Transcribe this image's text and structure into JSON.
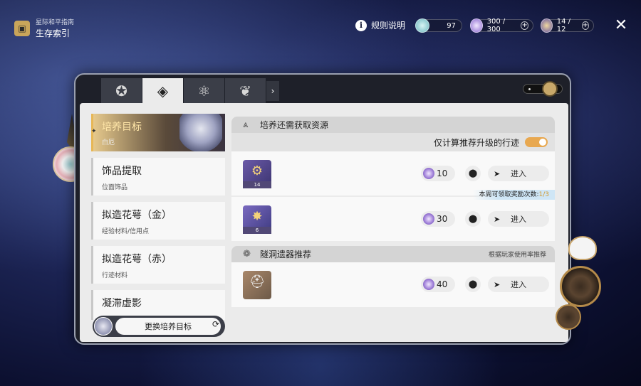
{
  "header": {
    "guide_small": "星际和平指南",
    "guide_big": "生存索引",
    "rules_label": "规则说明",
    "currency1_value": "97",
    "currency2_value": "300 / 300",
    "currency3_value": "14 / 12",
    "plus_symbol": "+",
    "close_symbol": "✕",
    "info_symbol": "i"
  },
  "tabs": [
    {
      "icon": "✪"
    },
    {
      "icon": "◈"
    },
    {
      "icon": "⚛"
    },
    {
      "icon": "❦"
    }
  ],
  "tab_more": "›",
  "sidebar": {
    "items": [
      {
        "title": "培养目标",
        "subtitle": "白厄"
      },
      {
        "title": "饰品提取",
        "subtitle": "位面饰品"
      },
      {
        "title": "拟造花萼（金）",
        "subtitle": "经验材料/信用点"
      },
      {
        "title": "拟造花萼（赤）",
        "subtitle": "行迹材料"
      },
      {
        "title": "凝滞虚影",
        "subtitle": ""
      }
    ],
    "switch_label": "更换培养目标",
    "refresh_symbol": "⟳",
    "pin_symbol": "✦"
  },
  "section1": {
    "title": "培养还需获取资源",
    "toggle_label": "仅计算推荐升级的行迹",
    "toggle_on": true,
    "rows": [
      {
        "count": "14",
        "cost": "10",
        "enter": "进入",
        "glyph": "⚙"
      },
      {
        "count": "6",
        "cost": "30",
        "enter": "进入",
        "glyph": "✸"
      }
    ],
    "weekly_prefix": "本周可领取奖励次数:",
    "weekly_value": "1/3"
  },
  "section2": {
    "title": "隧洞遗器推荐",
    "right_note": "根据玩家使用率推荐",
    "rows": [
      {
        "cost": "40",
        "enter": "进入",
        "glyph": "⛑"
      }
    ]
  },
  "icons": {
    "pin": "⬤",
    "arrow": "➤",
    "section1_icon": "⩓",
    "section2_icon": "❁"
  },
  "colors": {
    "accent_gold": "#e7b757",
    "toggle_on": "#e8a850",
    "highlight": "#d09a30"
  }
}
